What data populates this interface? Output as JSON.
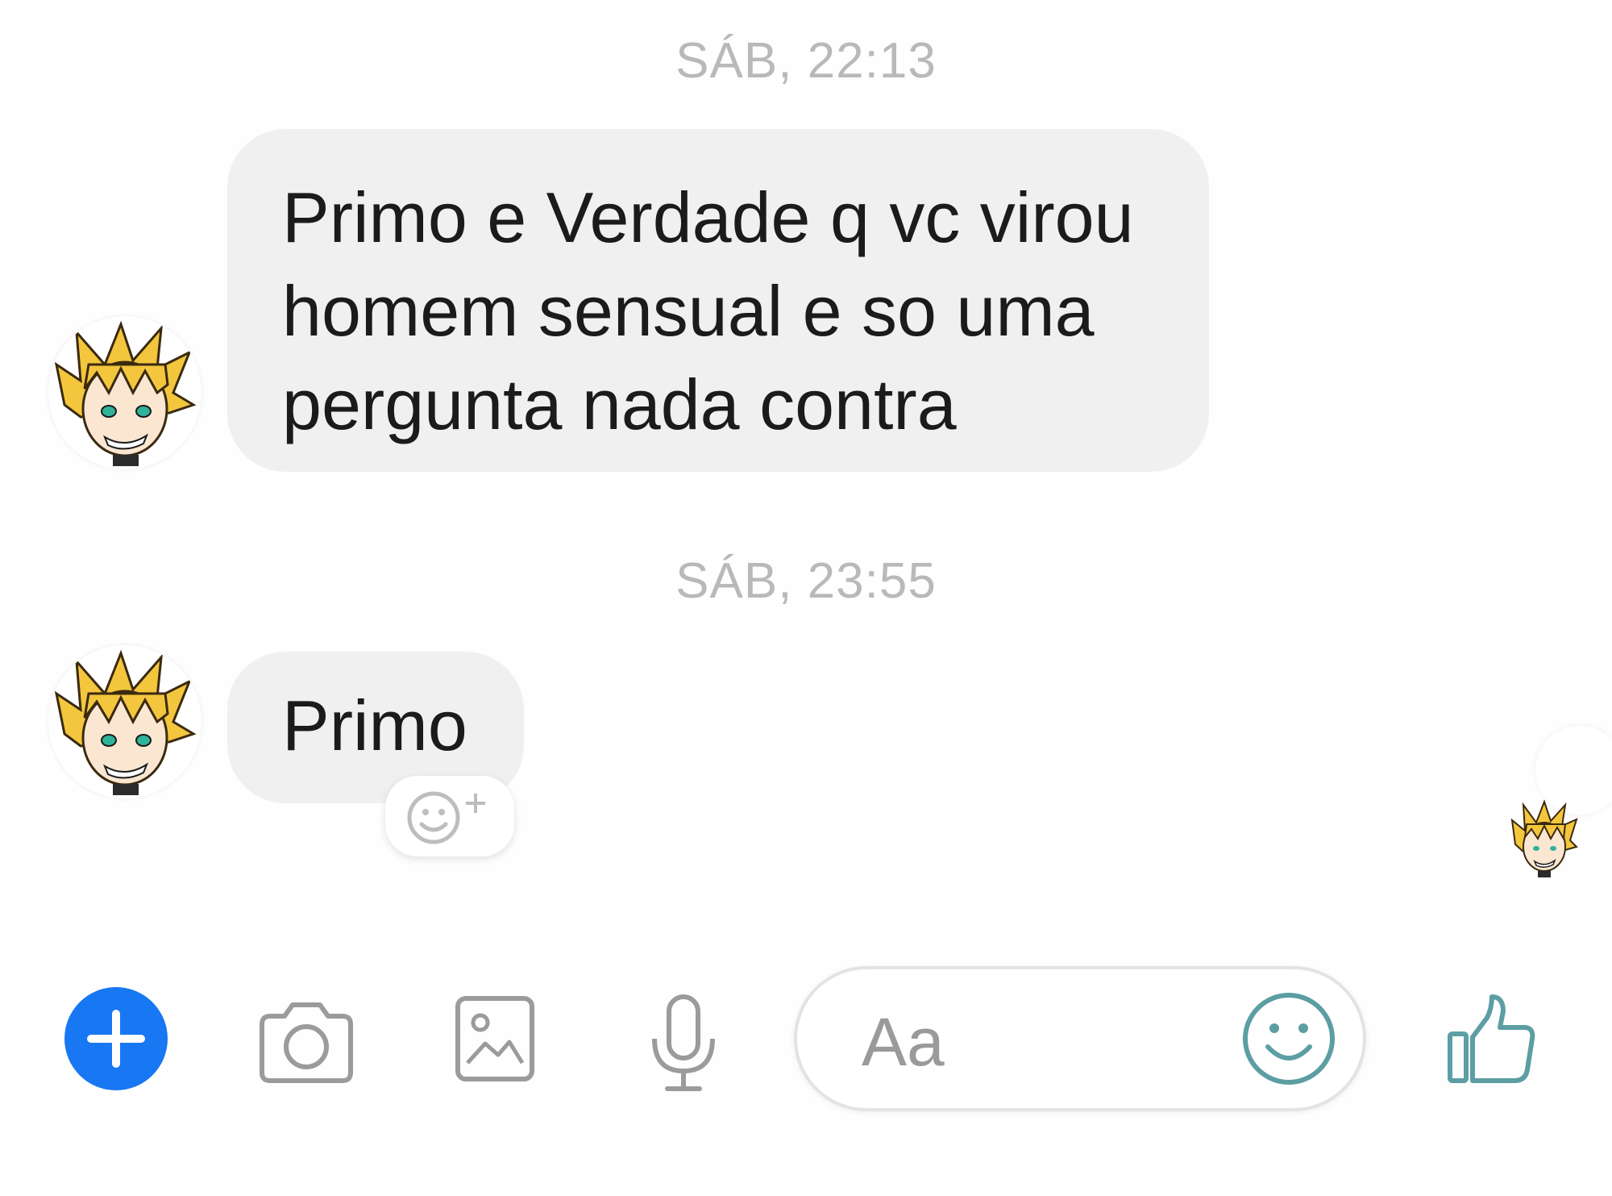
{
  "chat": {
    "timestamps": [
      "SÁB, 22:13",
      "SÁB, 23:55"
    ],
    "messages": [
      {
        "lines": [
          "Primo e Verdade q vc virou",
          "homem sensual e so uma",
          "pergunta nada contra"
        ]
      },
      {
        "lines": [
          "Primo"
        ]
      }
    ],
    "reaction_icon": "add-reaction-icon"
  },
  "composer": {
    "placeholder": "Aa"
  },
  "toolbar": {
    "icons": [
      "plus-icon",
      "camera-icon",
      "image-icon",
      "microphone-icon",
      "emoji-icon",
      "thumbs-up-icon"
    ]
  },
  "colors": {
    "accent": "#1877f2",
    "bubble": "#f0f0f0",
    "timestamp": "#b9b9b9",
    "icon_gray": "#9b9b9b",
    "icon_teal": "#5c9ea3"
  }
}
